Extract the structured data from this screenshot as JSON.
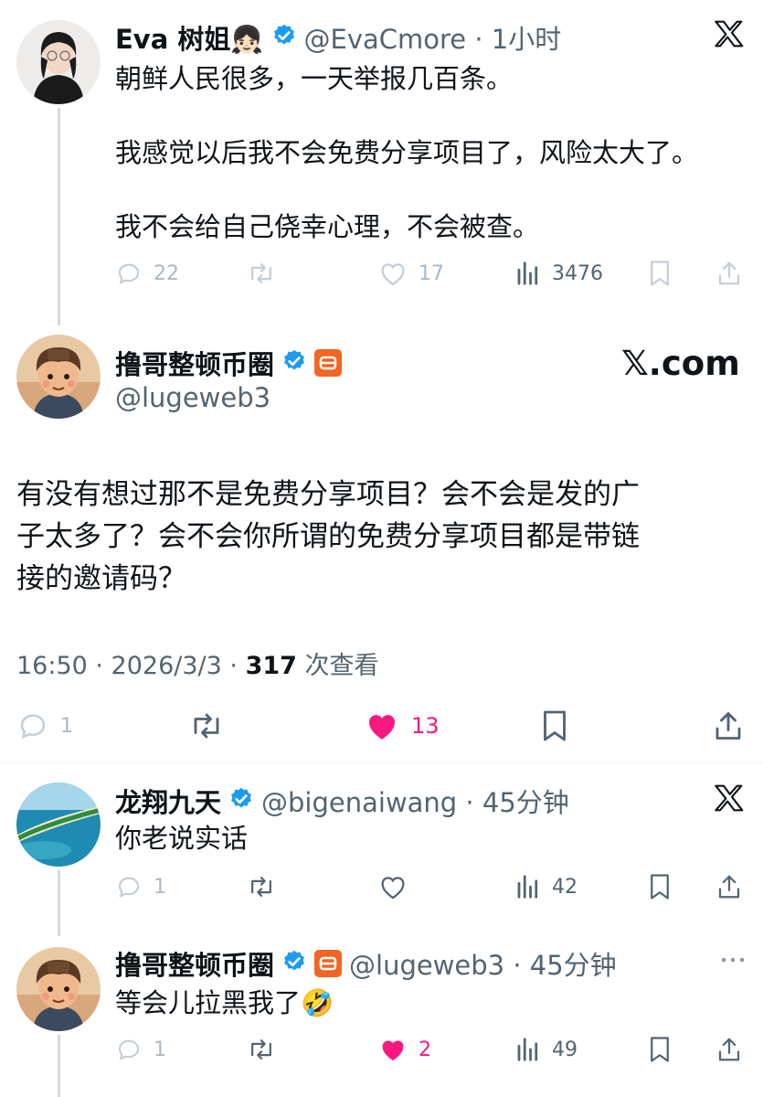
{
  "post1": {
    "name": "Eva 树姐👧🏻",
    "handle_time": "@EvaCmore · 1小时",
    "lines": [
      "朝鲜人民很多，一天举报几百条。",
      "我感觉以后我不会免费分享项目了，风险太大了。",
      "我不会给自己侥幸心理，不会被查。"
    ],
    "stats": {
      "replies": "22",
      "likes": "17",
      "views": "3476"
    }
  },
  "main": {
    "name": "撸哥整顿币圈",
    "handle": "@lugeweb3",
    "watermark": "𝕏.com",
    "text": [
      "有没有想过那不是免费分享项目？会不会是发的广",
      "子太多了？会不会你所谓的免费分享项目都是带链",
      "接的邀请码？"
    ],
    "meta_time": "16:50 · 2026/3/3 · ",
    "meta_views": "317",
    "meta_suffix": " 次查看",
    "stats": {
      "replies": "1",
      "likes": "13"
    }
  },
  "reply1": {
    "name": "龙翔九天",
    "handle_time": "@bigenaiwang · 45分钟",
    "text": "你老说实话",
    "stats": {
      "replies": "1",
      "views": "42"
    }
  },
  "reply2": {
    "name": "撸哥整顿币圈",
    "handle_time": "@lugeweb3 · 45分钟",
    "text": "等会儿拉黑我了🤣",
    "stats": {
      "replies": "1",
      "likes": "2",
      "views": "49"
    }
  },
  "colors": {
    "verified": "#1d9bf0",
    "like": "#f91880",
    "tag": "#f26522"
  }
}
